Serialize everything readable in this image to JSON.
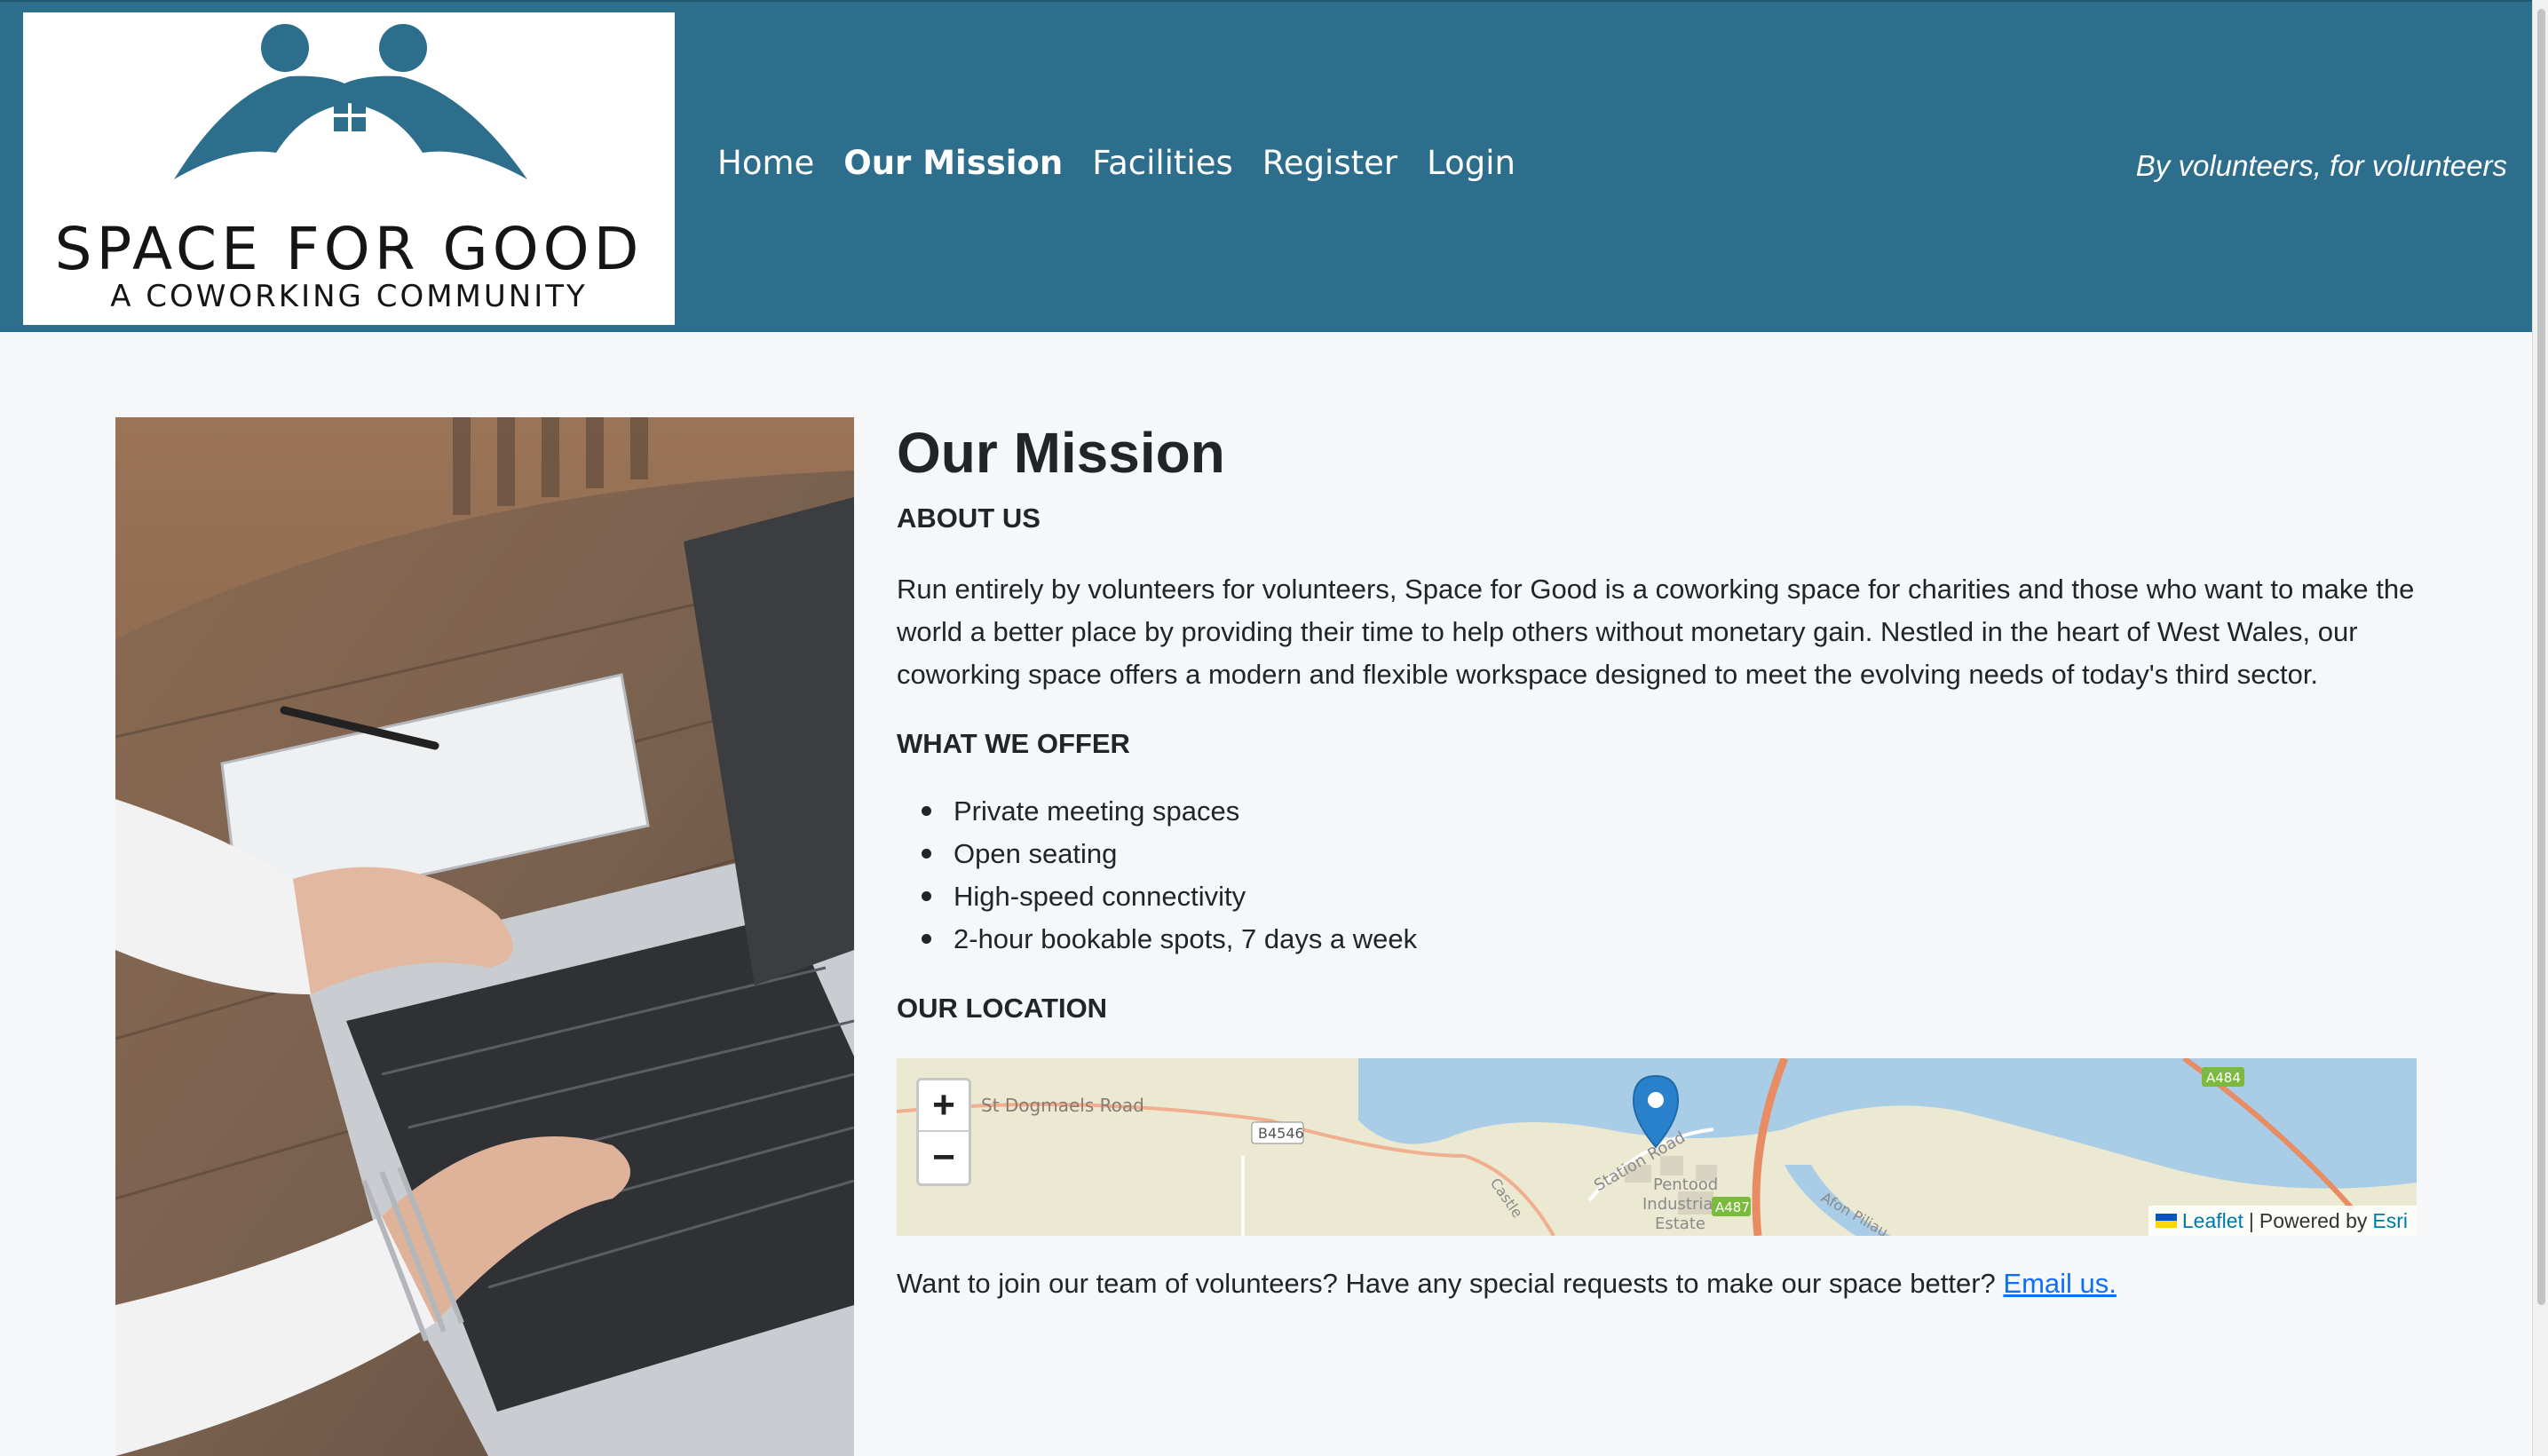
{
  "header": {
    "logo": {
      "title": "SPACE FOR GOOD",
      "subtitle": "A COWORKING COMMUNITY"
    },
    "nav": [
      {
        "label": "Home",
        "active": false
      },
      {
        "label": "Our Mission",
        "active": true
      },
      {
        "label": "Facilities",
        "active": false
      },
      {
        "label": "Register",
        "active": false
      },
      {
        "label": "Login",
        "active": false
      }
    ],
    "tagline": "By volunteers, for volunteers"
  },
  "main": {
    "title": "Our Mission",
    "about": {
      "heading": "ABOUT US",
      "text": "Run entirely by volunteers for volunteers, Space for Good is a coworking space for charities and those who want to make the world a better place by providing their time to help others without monetary gain. Nestled in the heart of West Wales, our coworking space offers a modern and flexible workspace designed to meet the evolving needs of today's third sector."
    },
    "offer": {
      "heading": "WHAT WE OFFER",
      "items": [
        "Private meeting spaces",
        "Open seating",
        "High-speed connectivity",
        "2-hour bookable spots, 7 days a week"
      ]
    },
    "location": {
      "heading": "OUR LOCATION",
      "map": {
        "zoom_in": "+",
        "zoom_out": "−",
        "labels": {
          "road1": "St Dogmaels Road",
          "b4546": "B4546",
          "station_road": "Station Road",
          "castle": "Castle",
          "estate1": "Pentood",
          "estate2": "Industrial",
          "estate3": "Estate",
          "a487": "A487",
          "afon": "Afon Piliau",
          "a484": "A484"
        },
        "attribution": {
          "leaflet": "Leaflet",
          "separator": "|",
          "powered_by": "Powered by",
          "esri": "Esri"
        }
      }
    },
    "closing": {
      "text": "Want to join our team of volunteers? Have any special requests to make our space better?",
      "link": "Email us."
    }
  },
  "colors": {
    "header_bg": "#2d6e8c",
    "page_bg": "#f6f7f9",
    "link": "#0d6efd",
    "logo_teal": "#2d6e8c"
  },
  "icons": [
    "home-window-icon",
    "people-roof-icon",
    "map-marker-icon",
    "ukraine-flag-icon"
  ]
}
